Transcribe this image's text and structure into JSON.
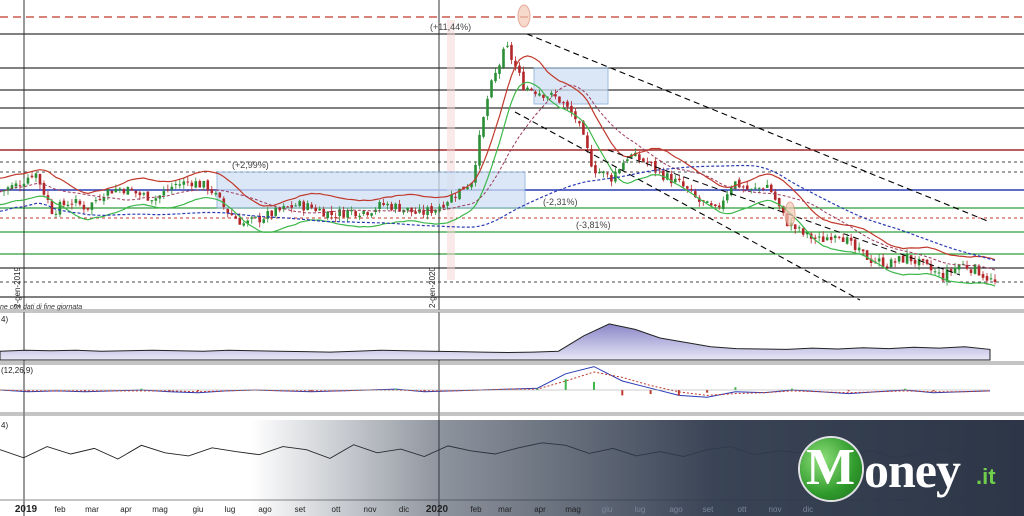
{
  "chart_data": [
    {
      "type": "candlestick",
      "title": "",
      "x_start_label": "2019",
      "x_tick_labels": [
        "2019",
        "feb",
        "mar",
        "apr",
        "mag",
        "giu",
        "lug",
        "ago",
        "set",
        "ott",
        "nov",
        "dic",
        "2020",
        "feb",
        "mar",
        "apr",
        "mag",
        "giu",
        "lug",
        "ago",
        "set",
        "ott",
        "nov",
        "dic"
      ],
      "vertical_date_labels": [
        "2-gen-2019",
        "2-gen-2020"
      ],
      "footnote": "ne con dati di fine giornata",
      "percent_annotations": [
        "(+11,44%)",
        "(+2,99%)",
        "(-2,31%)",
        "(-3,81%)"
      ],
      "price_path": [
        118,
        120,
        124,
        112,
        115,
        113,
        118,
        119,
        117,
        116,
        120,
        121,
        119,
        112,
        108,
        110,
        112,
        114,
        113,
        111,
        112,
        112,
        114,
        113,
        111,
        113,
        117,
        121,
        148,
        162,
        150,
        148,
        146,
        140,
        125,
        122,
        129,
        127,
        123,
        120,
        115,
        112,
        121,
        118,
        120,
        109,
        105,
        103,
        106,
        100,
        97,
        96,
        98,
        95,
        92,
        96,
        94,
        90
      ],
      "note": "price_path is an approximate relative price level read from the candles (no price axis printed)"
    },
    {
      "type": "area",
      "panel_label": "4)",
      "values": [
        20,
        22,
        21,
        22,
        20,
        21,
        22,
        21,
        20,
        22,
        21,
        20,
        19,
        18,
        20,
        22,
        21,
        20,
        19,
        18,
        17,
        18,
        20,
        55,
        82,
        70,
        50,
        40,
        30,
        26,
        25,
        24,
        27,
        25,
        28,
        26,
        29,
        27,
        30,
        24
      ]
    },
    {
      "type": "line",
      "panel_label": "(12,26,9)",
      "series": [
        {
          "values": [
            0,
            -2,
            -1,
            -2,
            -1,
            0,
            -2,
            -3,
            -1,
            0,
            -1,
            -2,
            -1,
            0,
            1,
            -2,
            -1,
            0,
            1,
            2,
            18,
            26,
            10,
            2,
            -6,
            -8,
            -2,
            -3,
            0,
            -2,
            -4,
            -2,
            0,
            -3,
            -2,
            -1
          ]
        },
        {
          "values": [
            0,
            -1,
            -1,
            -1,
            -1,
            -1,
            -1,
            -2,
            -1,
            0,
            -1,
            -1,
            -1,
            0,
            0,
            -1,
            -1,
            0,
            1,
            1,
            10,
            20,
            14,
            5,
            -2,
            -6,
            -4,
            -3,
            -1,
            -2,
            -3,
            -2,
            -1,
            -2,
            -2,
            -1
          ]
        }
      ]
    },
    {
      "type": "line",
      "panel_label": "4)",
      "values": [
        55,
        42,
        60,
        48,
        57,
        40,
        62,
        50,
        45,
        58,
        52,
        47,
        60,
        55,
        41,
        63,
        50,
        56,
        44,
        61,
        53,
        48,
        58,
        66,
        62,
        49,
        57,
        45,
        52,
        44,
        55,
        60,
        47,
        53,
        50,
        58,
        46,
        54,
        42,
        49,
        57,
        51,
        45
      ]
    }
  ],
  "brand": {
    "logo_letter": "M",
    "name_rest": "oney",
    "tld": ".it"
  }
}
